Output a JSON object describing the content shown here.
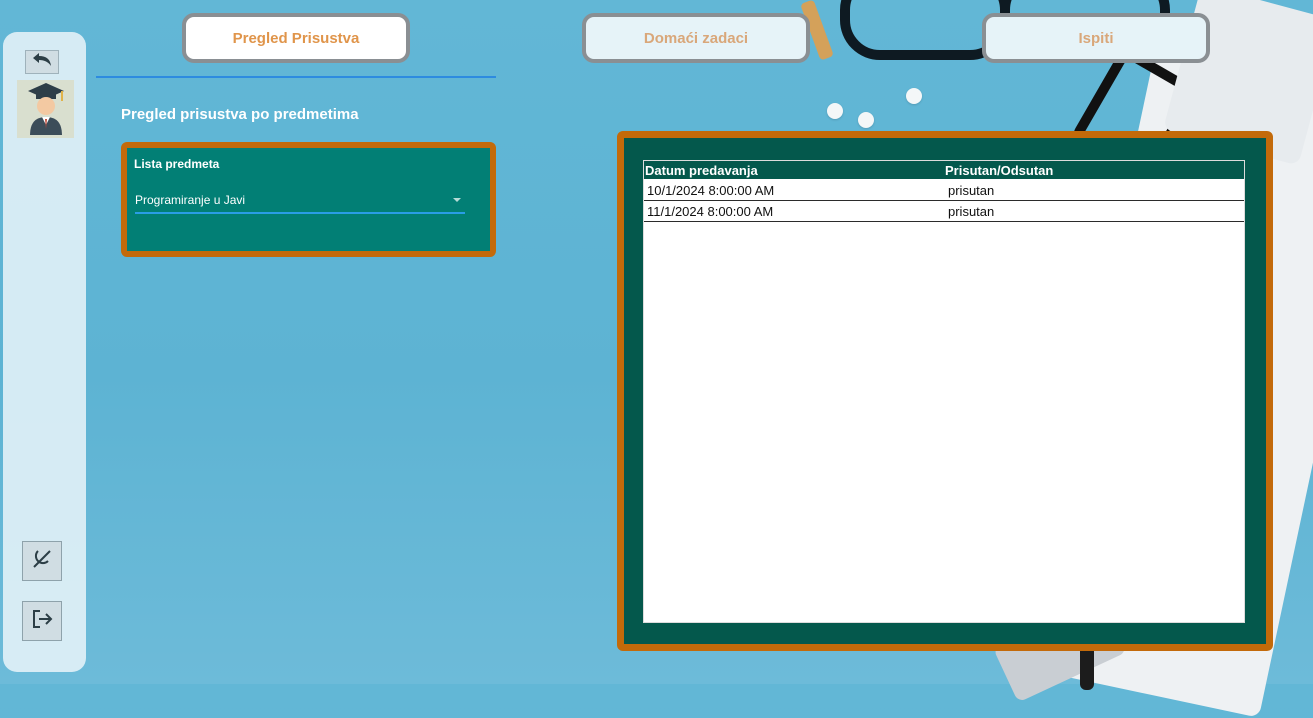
{
  "tabs": [
    {
      "label": "Pregled Prisustva",
      "active": true
    },
    {
      "label": "Domaći zadaci",
      "active": false
    },
    {
      "label": "Ispiti",
      "active": false
    }
  ],
  "sidebar": {
    "back_icon": "undo-arrow-icon",
    "avatar_icon": "graduate-student-icon",
    "theme_icon": "theme-toggle-icon",
    "logout_icon": "logout-icon"
  },
  "section_title": "Pregled prisustva po predmetima",
  "subject_list": {
    "label": "Lista predmeta",
    "selected": "Programiranje u Javi"
  },
  "attendance": {
    "columns": [
      "Datum predavanja",
      "Prisutan/Odsutan"
    ],
    "rows": [
      [
        "10/1/2024 8:00:00 AM",
        "prisutan"
      ],
      [
        "11/1/2024 8:00:00 AM",
        "prisutan"
      ]
    ]
  },
  "colors": {
    "panel_border": "#c36a0a",
    "panel_teal": "#027f75",
    "grid_header": "#04584c",
    "tab_text": "#e0954b",
    "underline": "#2d8be0"
  }
}
